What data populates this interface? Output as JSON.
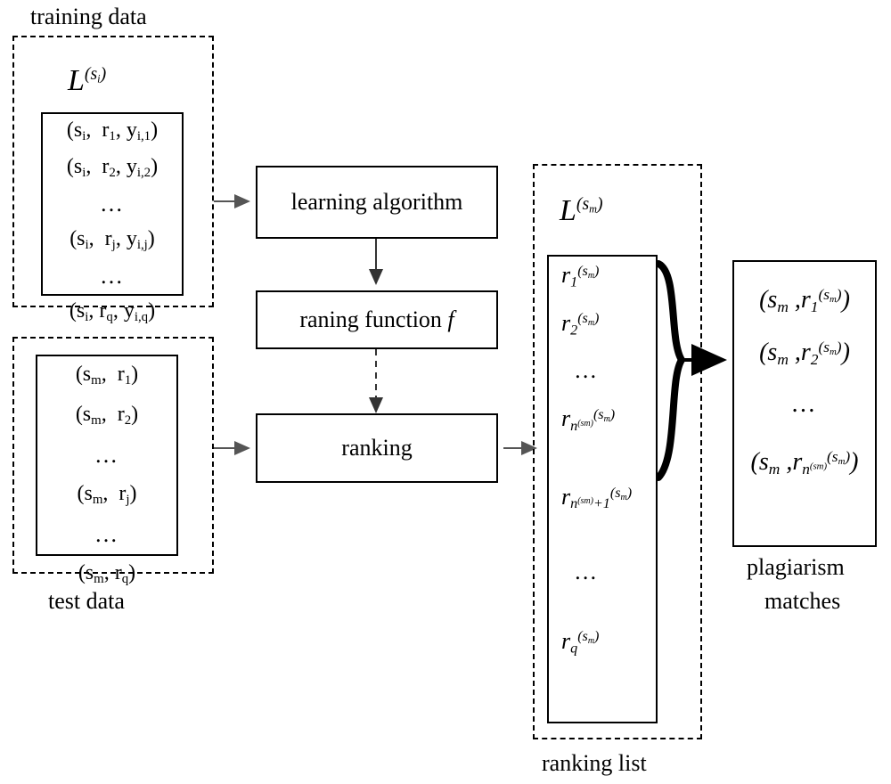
{
  "diagram": {
    "title_hidden": "",
    "labels": {
      "training_data": "training data",
      "test_data": "test data",
      "ranking_list": "ranking list",
      "plagiarism_matches_line1": "plagiarism",
      "plagiarism_matches_line2": "matches"
    },
    "training_box": {
      "symbol_L": "L",
      "symbol_sup": "(si)",
      "rows": [
        "(si,  r1, yi,1)",
        "(si,  r2, yi,2)",
        "…",
        "(si,  rj, yi,j)",
        "…",
        "(si,  rq, yi,q)"
      ]
    },
    "test_box": {
      "rows": [
        "(sm,  r1)",
        "(sm,  r2)",
        "…",
        "(sm,  rj)",
        "…",
        "(sm, rq)"
      ]
    },
    "processes": [
      {
        "id": "learning-algorithm",
        "label": "learning algorithm"
      },
      {
        "id": "ranking-function",
        "label": "raning function f"
      },
      {
        "id": "ranking",
        "label": "ranking"
      }
    ],
    "ranking_list_box": {
      "symbol_L": "L",
      "symbol_sup": "(sm)",
      "rows": [
        "r1(sm)",
        "r2(sm)",
        "…",
        "rn(sm)(sm)",
        "rn(sm)+1(sm)",
        "…",
        "rq(sm)"
      ]
    },
    "matches_box": {
      "rows": [
        "(sm , r1(sm))",
        "(sm , r2(sm))",
        "…",
        "(sm , rn(sm)(sm))"
      ]
    }
  }
}
